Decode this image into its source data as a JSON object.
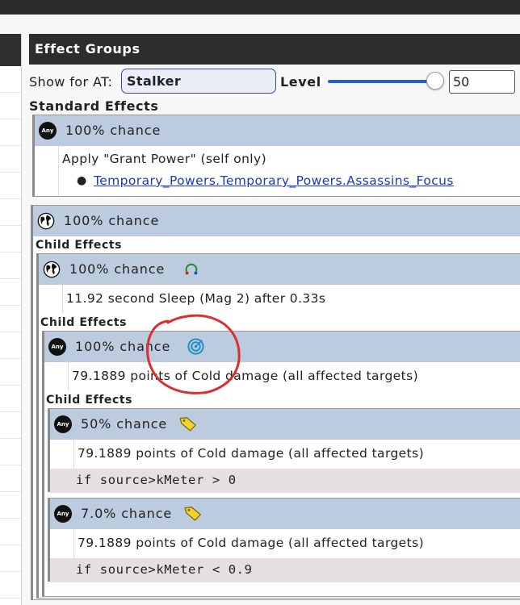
{
  "panel_title": "Effect Groups",
  "show_for_at": {
    "label": "Show for AT:",
    "value": "Stalker"
  },
  "level": {
    "label": "Level",
    "value": "50",
    "slider_fraction": 0.97
  },
  "standard_effects_title": "Standard Effects",
  "child_effects_label": "Child Effects",
  "effects": [
    {
      "icon": "any-icon",
      "icon_text": "Any",
      "chance": "100% chance",
      "description": "Apply \"Grant Power\" (self only)",
      "bullet": "●",
      "link": "Temporary_Powers.Temporary_Powers.Assassins_Focus"
    },
    {
      "icon": "globe-icon",
      "chance": "100% chance",
      "children": [
        {
          "icon": "globe-icon",
          "chance": "100% chance",
          "side_icon": "headphones-icon",
          "description": "11.92 second Sleep (Mag 2) after 0.33s",
          "children": [
            {
              "icon": "any-icon",
              "icon_text": "Any",
              "chance": "100% chance",
              "side_icon": "target-icon",
              "description": "79.1889 points of Cold damage (all affected targets)",
              "children": [
                {
                  "icon": "any-icon",
                  "icon_text": "Any",
                  "chance": "50% chance",
                  "side_icon": "tag-icon",
                  "description": "79.1889 points of Cold damage (all affected targets)",
                  "condition": "if source>kMeter > 0"
                },
                {
                  "icon": "any-icon",
                  "icon_text": "Any",
                  "chance": "7.0% chance",
                  "side_icon": "tag-icon",
                  "description": "79.1889 points of Cold damage (all affected targets)",
                  "condition": "if source>kMeter < 0.9"
                }
              ]
            }
          ]
        }
      ]
    }
  ]
}
